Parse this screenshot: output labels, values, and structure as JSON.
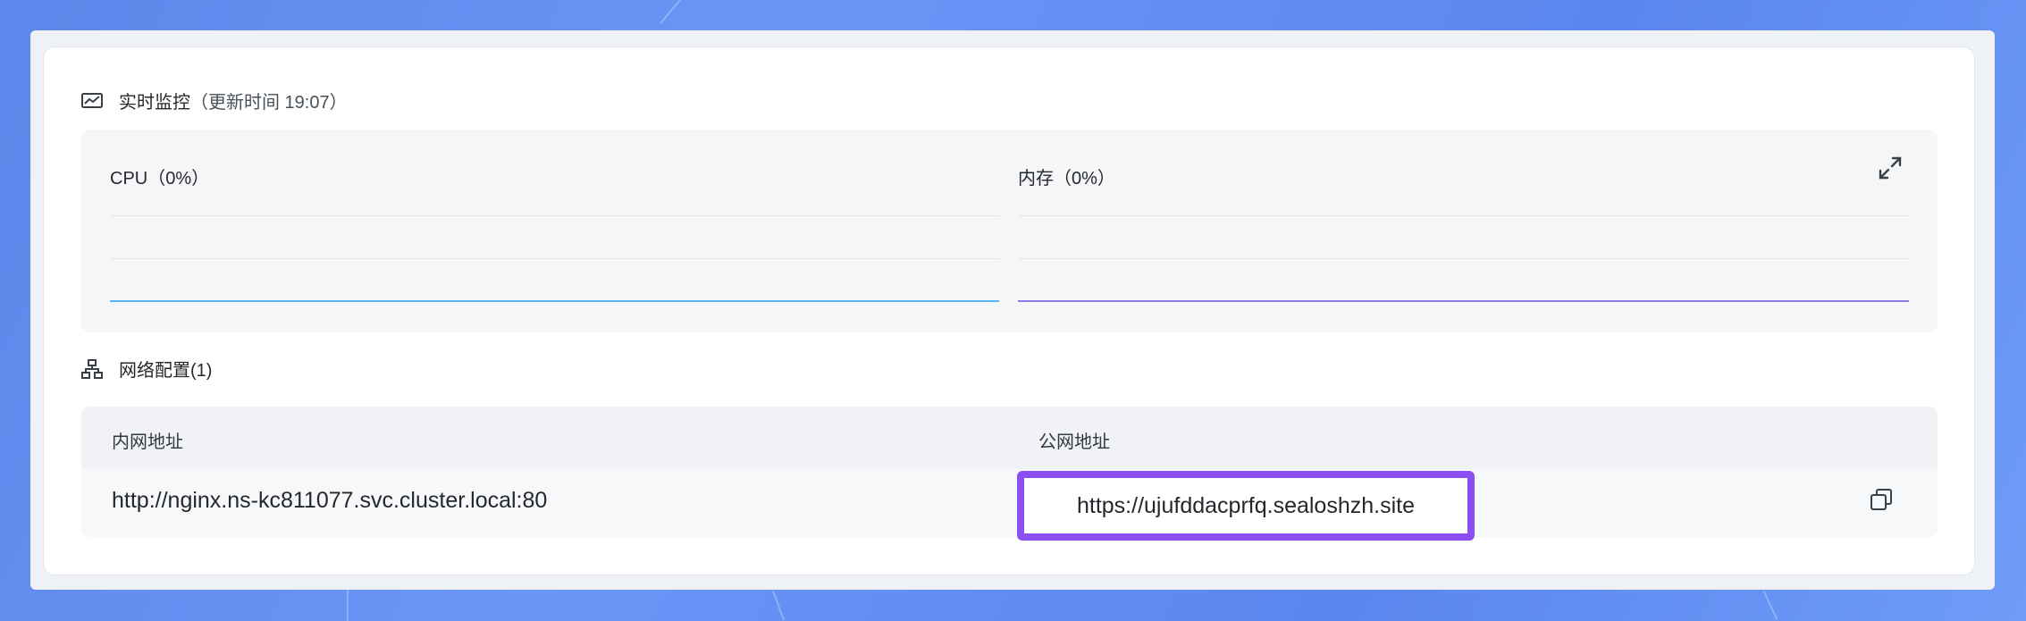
{
  "monitor": {
    "title": "实时监控",
    "update_label": "（更新时间  19:07）",
    "cpu_label": "CPU（0%）",
    "memory_label": "内存（0%）"
  },
  "network": {
    "title": "网络配置(1)",
    "headers": {
      "internal": "内网地址",
      "public": "公网地址"
    },
    "rows": [
      {
        "internal": "http://nginx.ns-kc811077.svc.cluster.local:80",
        "public": "https://ujufddacprfq.sealoshzh.site"
      }
    ]
  },
  "colors": {
    "cpu_line": "#56b4f0",
    "memory_line": "#8d7ae8",
    "highlight": "#8b4ef2"
  },
  "icons": {
    "monitor": "monitor-icon",
    "network": "network-icon",
    "expand": "expand-icon",
    "copy": "copy-icon"
  }
}
